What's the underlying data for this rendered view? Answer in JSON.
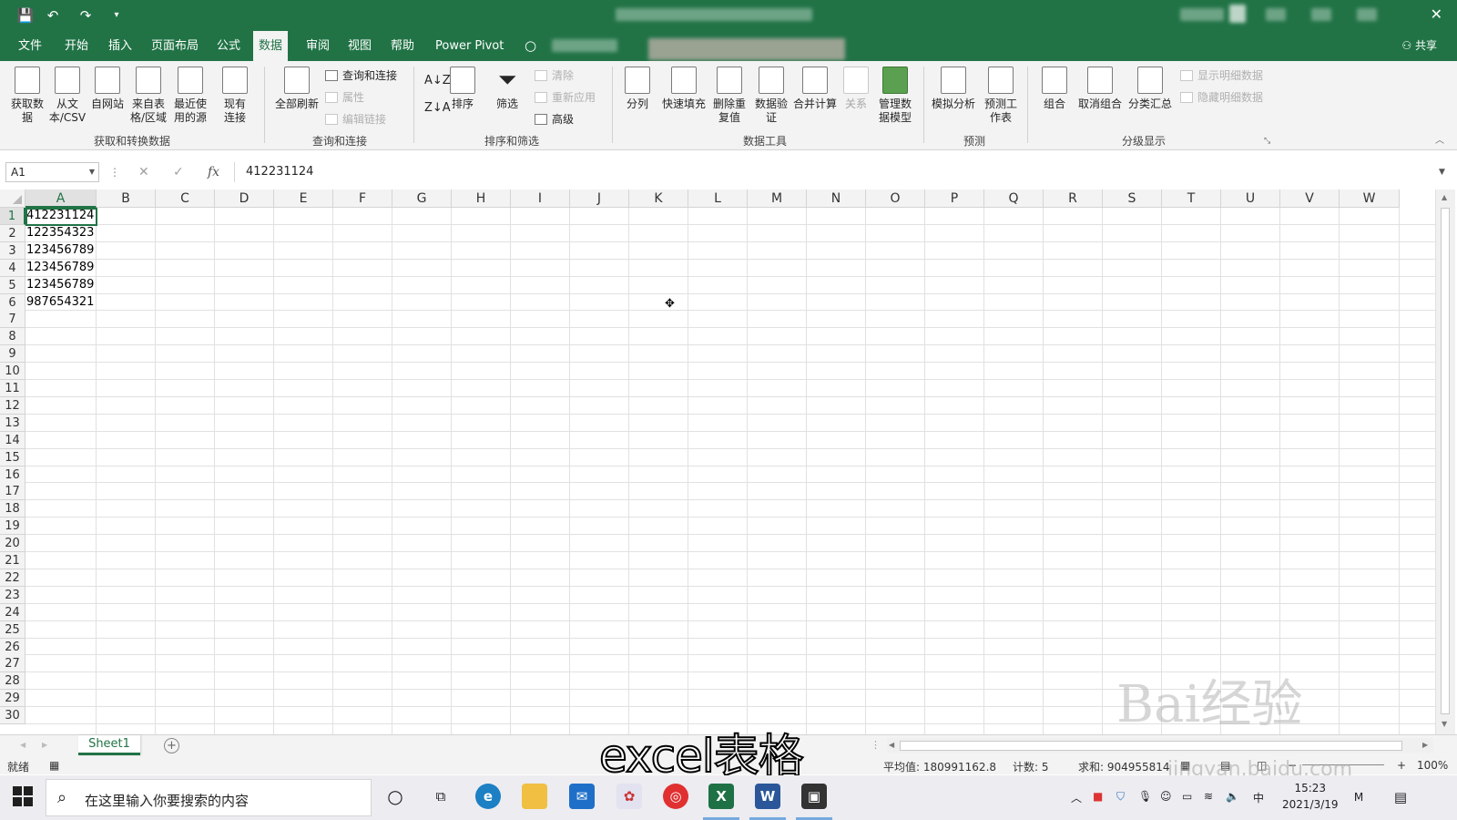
{
  "titlebar": {
    "undo": "↶",
    "redo": "↷",
    "save": "💾",
    "close": "✕"
  },
  "tabs": [
    {
      "label": "文件"
    },
    {
      "label": "开始"
    },
    {
      "label": "插入"
    },
    {
      "label": "页面布局"
    },
    {
      "label": "公式"
    },
    {
      "label": "数据",
      "active": true
    },
    {
      "label": "审阅"
    },
    {
      "label": "视图"
    },
    {
      "label": "帮助"
    },
    {
      "label": "Power Pivot"
    }
  ],
  "share_label": "共享",
  "ribbon": {
    "get_data": "获取数据",
    "from_text": "从文本/CSV",
    "from_web": "自网站",
    "from_table": "来自表格/区域",
    "recent_sources": "最近使用的源",
    "existing_conn": "现有连接",
    "refresh_all": "全部刷新",
    "queries_conn": "查询和连接",
    "properties": "属性",
    "edit_links": "编辑链接",
    "sort": "排序",
    "filter": "筛选",
    "clear": "清除",
    "reapply": "重新应用",
    "advanced": "高级",
    "text_to_cols": "分列",
    "flash_fill": "快速填充",
    "remove_dup": "删除重复值",
    "data_valid": "数据验证",
    "consolidate": "合并计算",
    "relationships": "关系",
    "manage_model": "管理数据模型",
    "what_if": "模拟分析",
    "forecast_sheet": "预测工作表",
    "group": "组合",
    "ungroup": "取消组合",
    "subtotal": "分类汇总",
    "show_detail": "显示明细数据",
    "hide_detail": "隐藏明细数据",
    "groups": {
      "get_transform": "获取和转换数据",
      "queries": "查询和连接",
      "sort_filter": "排序和筛选",
      "data_tools": "数据工具",
      "forecast": "预测",
      "outline": "分级显示"
    }
  },
  "formula_bar": {
    "name_box": "A1",
    "fx": "fx",
    "content": "412231124"
  },
  "columns": [
    "A",
    "B",
    "C",
    "D",
    "E",
    "F",
    "G",
    "H",
    "I",
    "J",
    "K",
    "L",
    "M",
    "N",
    "O",
    "P",
    "Q",
    "R",
    "S",
    "T",
    "U",
    "V",
    "W"
  ],
  "rows": [
    "1",
    "2",
    "3",
    "4",
    "5",
    "6",
    "7",
    "8",
    "9",
    "10",
    "11",
    "12",
    "13",
    "14",
    "15",
    "16",
    "17",
    "18",
    "19",
    "20",
    "21",
    "22",
    "23",
    "24",
    "25",
    "26",
    "27",
    "28",
    "29",
    "30"
  ],
  "cells_a": [
    "412231124",
    "122354323",
    "123456789",
    "123456789",
    "123456789",
    "987654321"
  ],
  "sheet_tab": "Sheet1",
  "caption": "excel表格",
  "status": {
    "ready": "就绪",
    "average": "平均值: 180991162.8",
    "count": "计数: 5",
    "sum": "求和: 904955814",
    "zoom": "100%"
  },
  "watermark": "Bai经验",
  "watermark_sub": "jingyan.baidu.com",
  "taskbar": {
    "search_placeholder": "在这里输入你要搜索的内容",
    "time": "15:23",
    "date": "2021/3/19",
    "ime": "中"
  }
}
